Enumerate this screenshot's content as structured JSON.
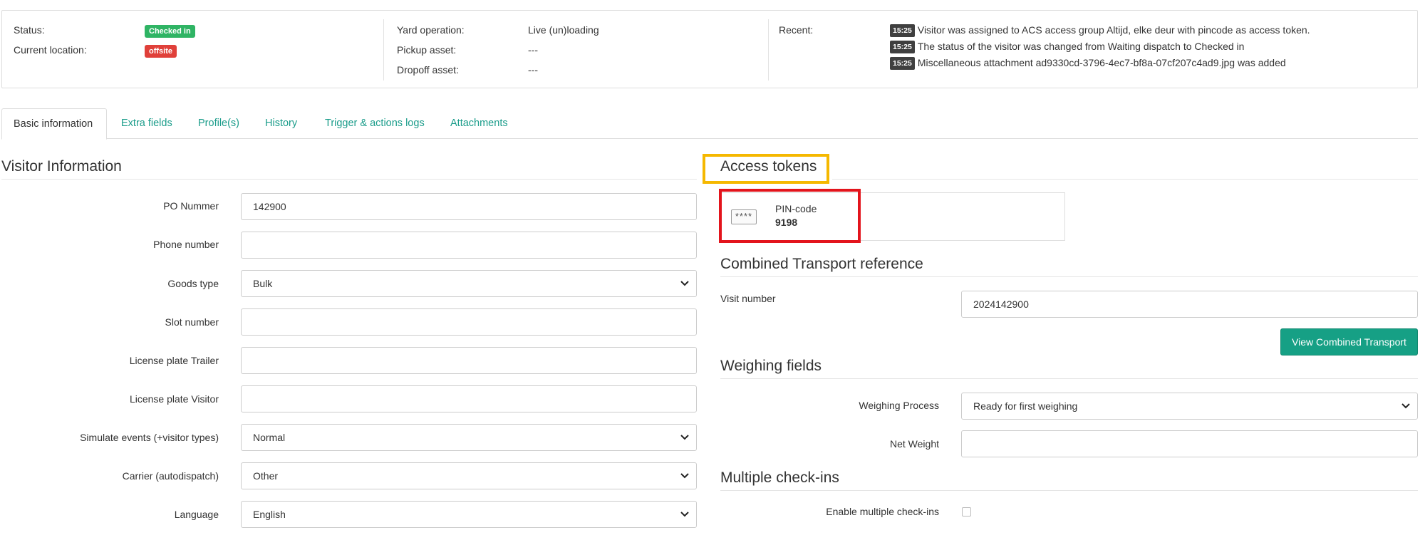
{
  "status_panel": {
    "status_label": "Status:",
    "status_value": "Checked in",
    "location_label": "Current location:",
    "location_value": "offsite",
    "yard_operation_label": "Yard operation:",
    "yard_operation_value": "Live (un)loading",
    "pickup_asset_label": "Pickup asset:",
    "pickup_asset_value": "---",
    "dropoff_asset_label": "Dropoff asset:",
    "dropoff_asset_value": "---",
    "recent_label": "Recent:",
    "recent": [
      {
        "time": "15:25",
        "text": "Visitor was assigned to ACS access group Altijd, elke deur with pincode as access token."
      },
      {
        "time": "15:25",
        "text": "The status of the visitor was changed from Waiting dispatch to Checked in"
      },
      {
        "time": "15:25",
        "text": "Miscellaneous attachment ad9330cd-3796-4ec7-bf8a-07cf207c4ad9.jpg was added"
      }
    ]
  },
  "tabs": [
    {
      "label": "Basic information"
    },
    {
      "label": "Extra fields"
    },
    {
      "label": "Profile(s)"
    },
    {
      "label": "History"
    },
    {
      "label": "Trigger & actions logs"
    },
    {
      "label": "Attachments"
    }
  ],
  "visitor_info": {
    "title": "Visitor Information",
    "fields": [
      {
        "label": "PO Nummer",
        "value": "142900"
      },
      {
        "label": "Phone number",
        "value": ""
      },
      {
        "label": "Goods type",
        "value": "Bulk"
      },
      {
        "label": "Slot number",
        "value": ""
      },
      {
        "label": "License plate Trailer",
        "value": ""
      },
      {
        "label": "License plate Visitor",
        "value": ""
      },
      {
        "label": "Simulate events (+visitor types)",
        "value": "Normal"
      },
      {
        "label": "Carrier (autodispatch)",
        "value": "Other"
      },
      {
        "label": "Language",
        "value": "English"
      }
    ]
  },
  "access_tokens": {
    "title": "Access tokens",
    "icon_text": "****",
    "token_type": "PIN-code",
    "token_value": "9198"
  },
  "combined_transport": {
    "title": "Combined Transport reference",
    "visit_number_label": "Visit number",
    "visit_number_value": "2024142900",
    "button_label": "View Combined Transport"
  },
  "weighing": {
    "title": "Weighing fields",
    "process_label": "Weighing Process",
    "process_value": "Ready for first weighing",
    "net_weight_label": "Net Weight",
    "net_weight_value": ""
  },
  "multiple_checkins": {
    "title": "Multiple check-ins",
    "enable_label": "Enable multiple check-ins"
  },
  "colors": {
    "accent": "#16a085",
    "link": "#1a9c8a",
    "badge_green": "#2fb464",
    "badge_red": "#e0403a",
    "highlight_yellow": "#f5b800",
    "highlight_red": "#e3141c"
  }
}
